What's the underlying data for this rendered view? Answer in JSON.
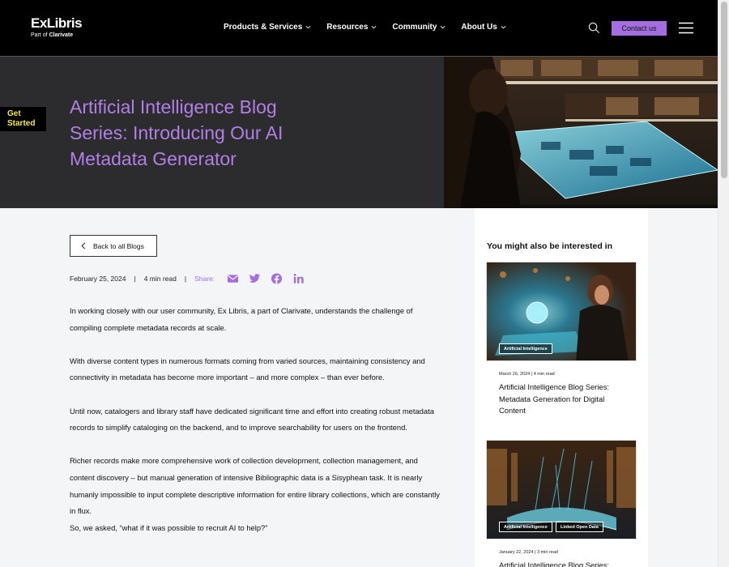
{
  "header": {
    "logo_brand": "ExLibris",
    "logo_sub_prefix": "Part of ",
    "logo_sub_company": "Clarivate",
    "nav": [
      {
        "label": "Products & Services"
      },
      {
        "label": "Resources"
      },
      {
        "label": "Community"
      },
      {
        "label": "About Us"
      }
    ],
    "contact_label": "Contact us"
  },
  "hero": {
    "title": "Artificial Intelligence Blog Series: Introducing Our AI Metadata Generator",
    "get_started": "Get Started"
  },
  "article": {
    "back_label": "Back to all Blogs",
    "date": "February 25, 2024",
    "read_time": "4 min read",
    "share_label": "Share:",
    "paragraphs": [
      "In working closely with our user community, Ex Libris, a part of Clarivate, understands the challenge of compiling complete metadata records at scale.",
      "With diverse content types in numerous formats coming from varied sources, maintaining consistency and connectivity in metadata has become more important – and more complex – than ever before.",
      "Until now, catalogers and library staff have dedicated significant time and effort into creating robust metadata records to simplify cataloging on the backend, and to improve searchability for users on the frontend.",
      "Richer records make more comprehensive work of collection development, collection management, and content discovery – but manual generation of intensive Bibliographic data is a Sisyphean task. It is nearly humanly impossible to input complete descriptive information for entire library collections, which are constantly in flux.",
      "So, we asked, “what if it was possible to recruit AI to help?”"
    ]
  },
  "sidebar": {
    "title": "You might also be interested in",
    "cards": [
      {
        "tags": [
          "Artificial Intelligence"
        ],
        "date": "March 26, 2024 | 4 min read",
        "title": "Artificial Intelligence Blog Series: Metadata Generation for Digital Content"
      },
      {
        "tags": [
          "Artificial Intelligence",
          "Linked Open Data"
        ],
        "date": "January 22, 2024 | 3 min read",
        "title": "Artificial Intelligence Blog Series:"
      }
    ]
  },
  "colors": {
    "accent_purple": "#a46ee0",
    "title_purple": "#b17fe6",
    "get_started_yellow": "#f0e94a",
    "header_black": "#000000",
    "hero_dark": "#2c2c2e"
  },
  "icons": {
    "search": "search-icon",
    "menu": "hamburger-menu-icon",
    "share": [
      "email-icon",
      "twitter-icon",
      "facebook-icon",
      "linkedin-icon"
    ]
  }
}
